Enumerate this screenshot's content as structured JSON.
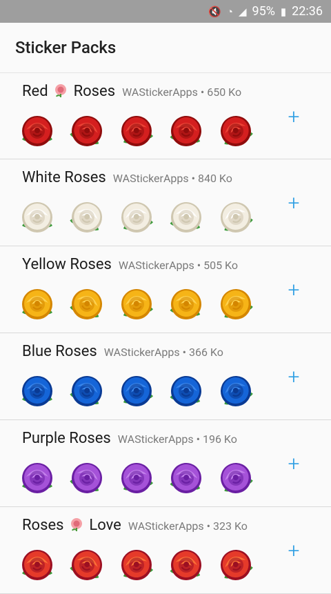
{
  "status": {
    "battery": "95%",
    "time": "22:36"
  },
  "header": {
    "title": "Sticker Packs"
  },
  "packs": [
    {
      "name_before": "Red",
      "name_after": "Roses",
      "has_emoji": true,
      "publisher": "WAStickerApps",
      "size": "650 Ko",
      "petal": "#d41f1f",
      "dark": "#8f0c0c",
      "light": "#f04a3a"
    },
    {
      "name_before": "White Roses",
      "name_after": "",
      "has_emoji": false,
      "publisher": "WAStickerApps",
      "size": "840 Ko",
      "petal": "#f3eee2",
      "dark": "#cfc7b0",
      "light": "#ffffff"
    },
    {
      "name_before": "Yellow Roses",
      "name_after": "",
      "has_emoji": false,
      "publisher": "WAStickerApps",
      "size": "505 Ko",
      "petal": "#f6b417",
      "dark": "#d48600",
      "light": "#ffd75a"
    },
    {
      "name_before": "Blue Roses",
      "name_after": "",
      "has_emoji": false,
      "publisher": "WAStickerApps",
      "size": "366 Ko",
      "petal": "#1565d8",
      "dark": "#0a3a93",
      "light": "#3f8cf0"
    },
    {
      "name_before": "Purple Roses",
      "name_after": "",
      "has_emoji": false,
      "publisher": "WAStickerApps",
      "size": "196 Ko",
      "petal": "#a552d8",
      "dark": "#6a1fa3",
      "light": "#c98af0"
    },
    {
      "name_before": "Roses",
      "name_after": "Love",
      "has_emoji": true,
      "publisher": "WAStickerApps",
      "size": "323 Ko",
      "petal": "#e53a2a",
      "dark": "#9b0f22",
      "light": "#ff7a3a"
    }
  ],
  "icons": {
    "add": "plus-icon",
    "emoji": "rose-emoji-icon"
  }
}
